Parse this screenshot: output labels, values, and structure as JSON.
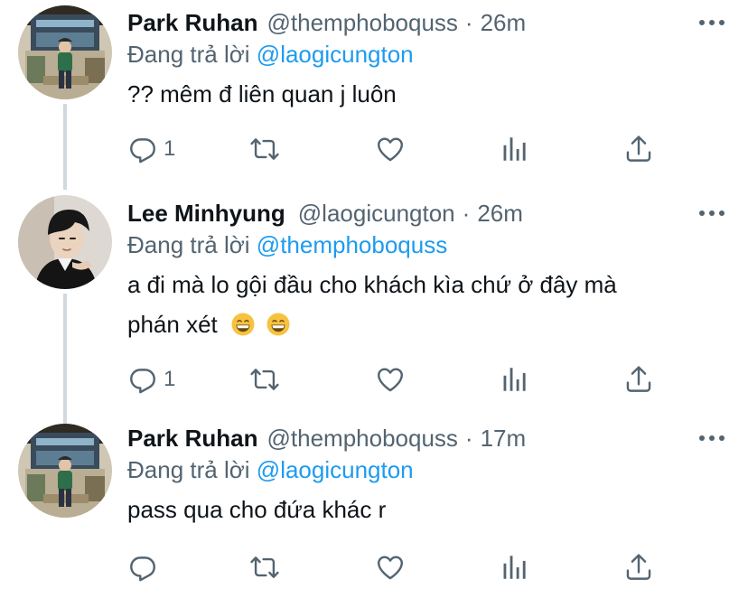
{
  "tweets": [
    {
      "display_name": "Park Ruhan",
      "handle": "@themphoboquss",
      "separator": "·",
      "time": "26m",
      "reply_prefix": "Đang trả lời",
      "reply_to": "@laogicungton",
      "body": "?? mêm đ liên quan j luôn",
      "reply_count": "1"
    },
    {
      "display_name": "Lee Minhyung",
      "handle": "@laogicungton",
      "separator": "·",
      "time": "26m",
      "reply_prefix": "Đang trả lời",
      "reply_to": "@themphoboquss",
      "body_line1": "a đi mà lo gội đầu cho khách kìa chứ ở đây mà",
      "body_line2": "phán xét",
      "emojis": [
        "grinning-face-emoji",
        "grinning-face-emoji"
      ],
      "reply_count": "1"
    },
    {
      "display_name": "Park Ruhan",
      "handle": "@themphoboquss",
      "separator": "·",
      "time": "17m",
      "reply_prefix": "Đang trả lời",
      "reply_to": "@laogicungton",
      "body": "pass qua cho đứa khác r",
      "reply_count": ""
    }
  ],
  "colors": {
    "text": "#0f1419",
    "secondary": "#536471",
    "accent": "#1d9bf0",
    "thread_line": "#cfd9de"
  }
}
